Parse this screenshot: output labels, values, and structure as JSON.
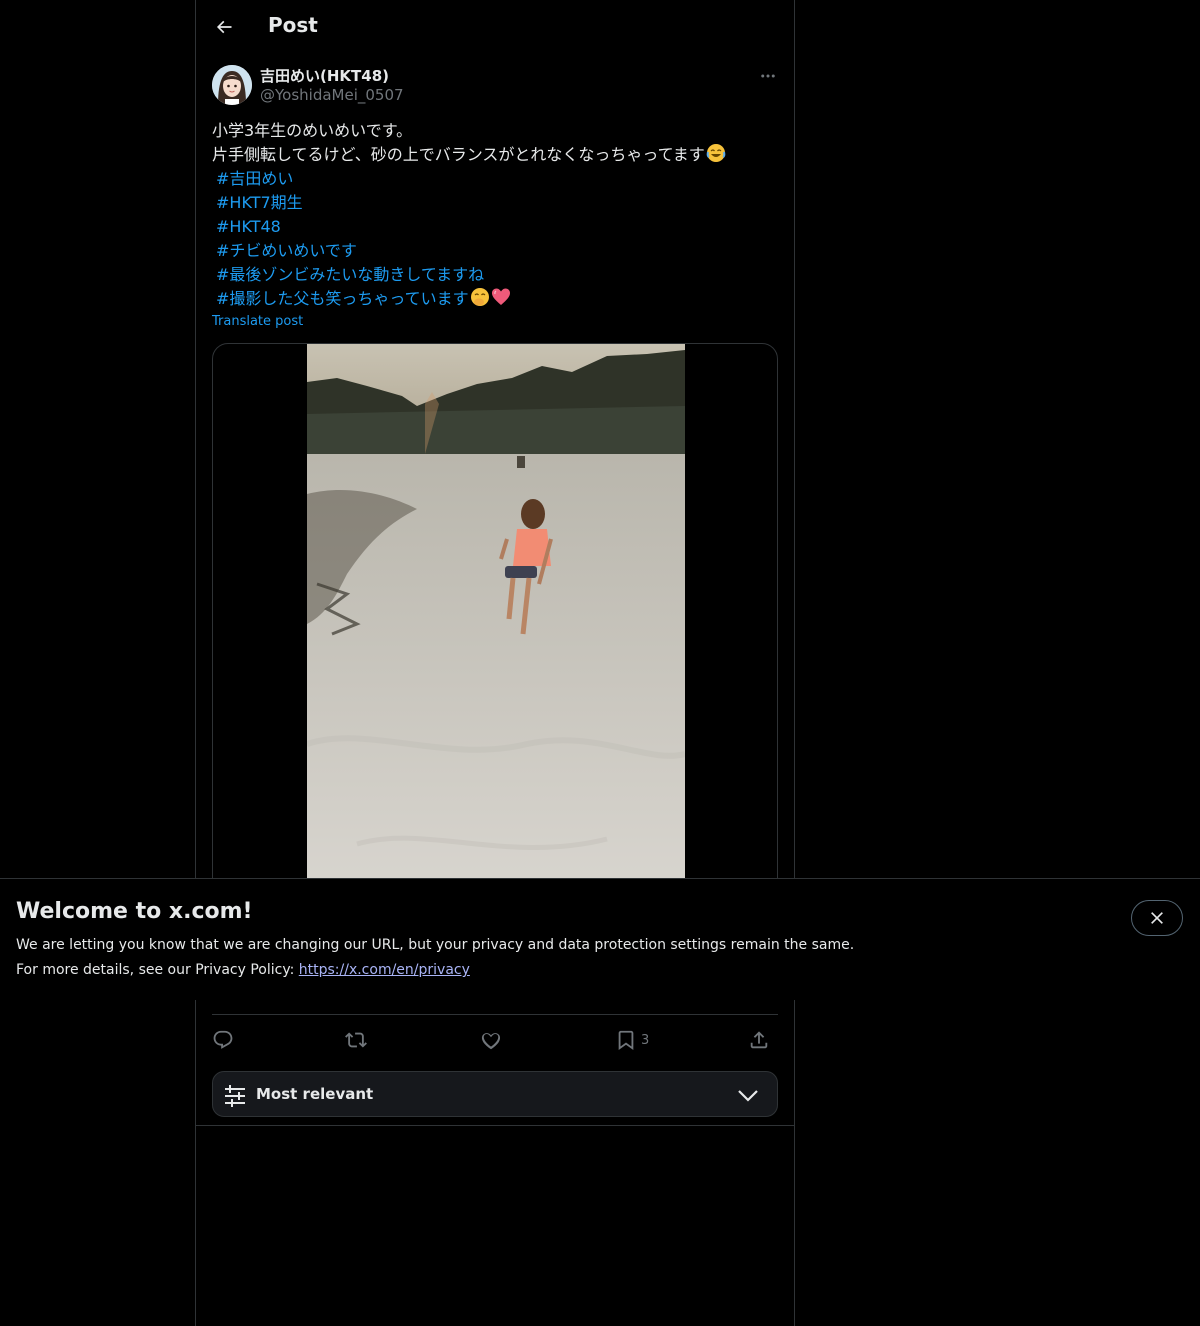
{
  "header": {
    "title": "Post"
  },
  "post": {
    "author": {
      "display_name": "吉田めい(HKT48)",
      "handle": "@YoshidaMei_0507"
    },
    "text_lines": [
      "小学3年生のめいめいです。",
      "片手側転してるけど、砂の上でバランスがとれなくなっちゃってます"
    ],
    "hashtags": [
      "#吉田めい",
      "#HKT7期生",
      "#HKT48",
      "#チビめいめいです",
      "#最後ゾンビみたいな動きしてますね",
      "#撮影した父も笑っちゃっています"
    ],
    "translate_label": "Translate post",
    "actions": {
      "reply_icon": "reply-icon",
      "repost_icon": "repost-icon",
      "like_icon": "heart-icon",
      "bookmark_count": "3",
      "share_icon": "share-icon"
    }
  },
  "sort": {
    "label": "Most relevant"
  },
  "banner": {
    "title": "Welcome to x.com!",
    "line1": "We are letting you know that we are changing our URL, but your privacy and data protection settings remain the same.",
    "line2_prefix": "For more details, see our Privacy Policy: ",
    "link_text": "https://x.com/en/privacy"
  },
  "colors": {
    "background": "#000000",
    "text": "#e7e9ea",
    "secondary": "#71767b",
    "accent": "#1d9bf0",
    "border": "#2f3336"
  }
}
